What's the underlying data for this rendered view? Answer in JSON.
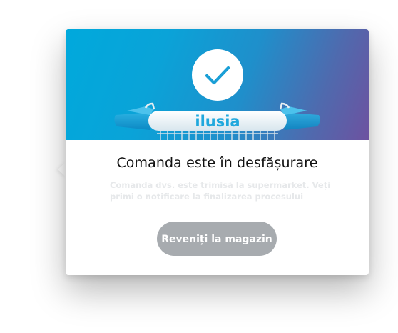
{
  "dialog": {
    "title": "Comanda este în desfășurare",
    "description": "Comanda dvs. este trimisă la supermarket. Veți primi o notificare la finalizarea procesului",
    "button_label": "Reveniți la magazin",
    "success_icon": "check-icon",
    "illustration": {
      "name": "shopping-cart-handle",
      "brand_text": "ilusia"
    }
  },
  "colors": {
    "banner_start": "#00a9dc",
    "banner_end": "#6d52a0",
    "check": "#1a9fd6",
    "brand_text": "#1fa8dd",
    "button_bg": "#a7abaf",
    "title": "#111111"
  }
}
